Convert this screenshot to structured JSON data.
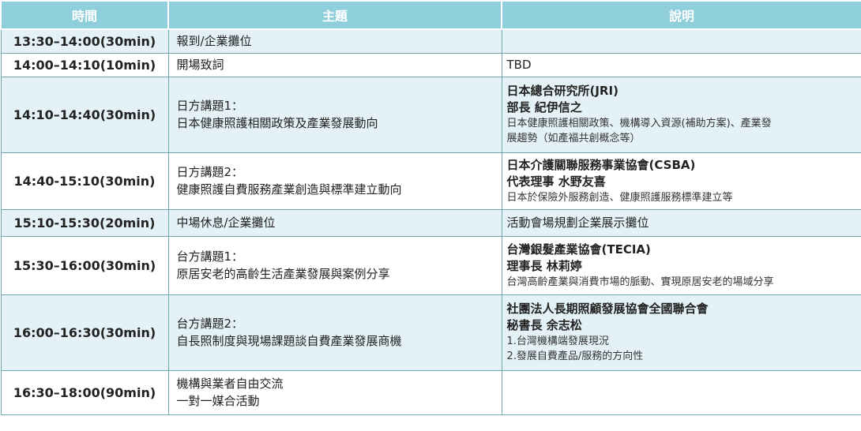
{
  "headers": {
    "time": "時間",
    "topic": "主題",
    "desc": "說明"
  },
  "rows": [
    {
      "time": "13:30–14:00(30min)",
      "topic": [
        "報到/企業攤位"
      ],
      "org": "",
      "person": "",
      "notes": [],
      "plain": ""
    },
    {
      "time": "14:00–14:10(10min)",
      "topic": [
        "開場致詞"
      ],
      "org": "",
      "person": "",
      "notes": [],
      "plain": "TBD"
    },
    {
      "time": "14:10–14:40(30min)",
      "topic": [
        "日方講題1：",
        "日本健康照護相關政策及產業發展動向"
      ],
      "org": "日本總合研究所(JRI)",
      "person": "部長 紀伊信之",
      "notes": [
        "日本健康照護相關政策、機構導入資源(補助方案)、產業發",
        "展趨勢（如產福共創概念等）"
      ],
      "plain": ""
    },
    {
      "time": "14:40-15:10(30min)",
      "topic": [
        "日方講題2：",
        "健康照護自費服務產業創造與標準建立動向"
      ],
      "org": "日本介護關聯服務事業協會(CSBA)",
      "person": "代表理事 水野友喜",
      "notes": [
        "日本於保險外服務創造、健康照護服務標準建立等"
      ],
      "plain": ""
    },
    {
      "time": "15:10-15:30(20min)",
      "topic": [
        "中場休息/企業攤位"
      ],
      "org": "",
      "person": "",
      "notes": [],
      "plain": "活動會場規劃企業展示攤位"
    },
    {
      "time": "15:30–16:00(30min)",
      "topic": [
        "台方講題1：",
        "原居安老的高齡生活產業發展與案例分享"
      ],
      "org": "台灣銀髮產業協會(TECIA)",
      "person": "理事長 林莉婷",
      "notes": [
        "台灣高齡產業與消費市場的脈動、實現原居安老的場域分享"
      ],
      "plain": ""
    },
    {
      "time": "16:00–16:30(30min)",
      "topic": [
        "台方講題2：",
        "自長照制度與現場課題談自費產業發展商機"
      ],
      "org": "社團法人長期照顧發展協會全國聯合會",
      "person": "秘書長 余志松",
      "notes": [
        "1.台灣機構端發展現況",
        "2.發展自費產品/服務的方向性"
      ],
      "plain": ""
    },
    {
      "time": "16:30–18:00(90min)",
      "topic": [
        "機構與業者自由交流",
        "一對一媒合活動"
      ],
      "org": "",
      "person": "",
      "notes": [],
      "plain": ""
    }
  ]
}
